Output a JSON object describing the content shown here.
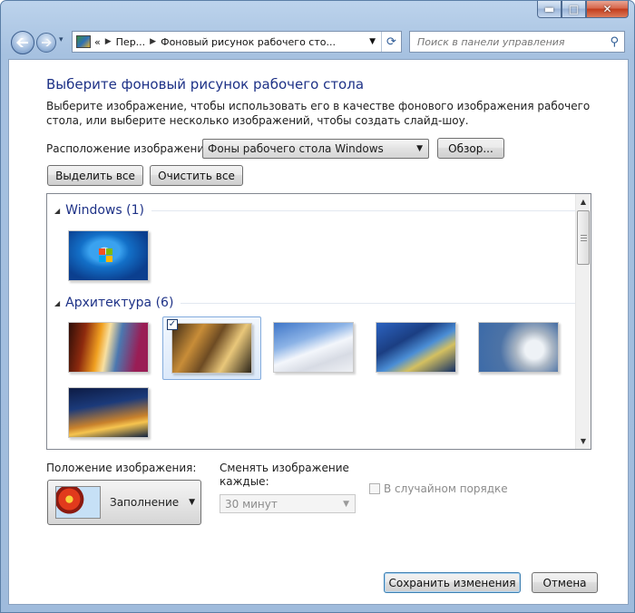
{
  "window": {
    "controls": {
      "minimize": "▬",
      "maximize": "□",
      "close": "✕"
    }
  },
  "nav": {
    "history_dropdown": "▾",
    "address_overflow": "«",
    "breadcrumb": [
      "Пер...",
      "Фоновый рисунок рабочего сто..."
    ],
    "refresh": "⟳",
    "search_placeholder": "Поиск в панели управления"
  },
  "page": {
    "title": "Выберите фоновый рисунок рабочего стола",
    "description": "Выберите изображение, чтобы использовать его в качестве фонового изображения рабочего стола, или выберите несколько изображений, чтобы создать слайд-шоу.",
    "location_label": "Расположение изображения:",
    "location_value": "Фоны рабочего стола Windows",
    "browse_button": "Обзор...",
    "select_all_button": "Выделить все",
    "clear_all_button": "Очистить все"
  },
  "gallery": {
    "groups": [
      {
        "label": "Windows (1)",
        "items": 1
      },
      {
        "label": "Архитектура (6)",
        "items": 6,
        "selected_index": 1
      }
    ]
  },
  "bottom": {
    "position_label": "Положение изображения:",
    "position_value": "Заполнение",
    "change_label": "Сменять изображение каждые:",
    "interval_value": "30 минут",
    "shuffle_label": "В случайном порядке",
    "save_button": "Сохранить изменения",
    "cancel_button": "Отмена"
  },
  "colors": {
    "heading": "#1e3287",
    "frame": "#a6c1e0",
    "selection": "#84acdd"
  }
}
